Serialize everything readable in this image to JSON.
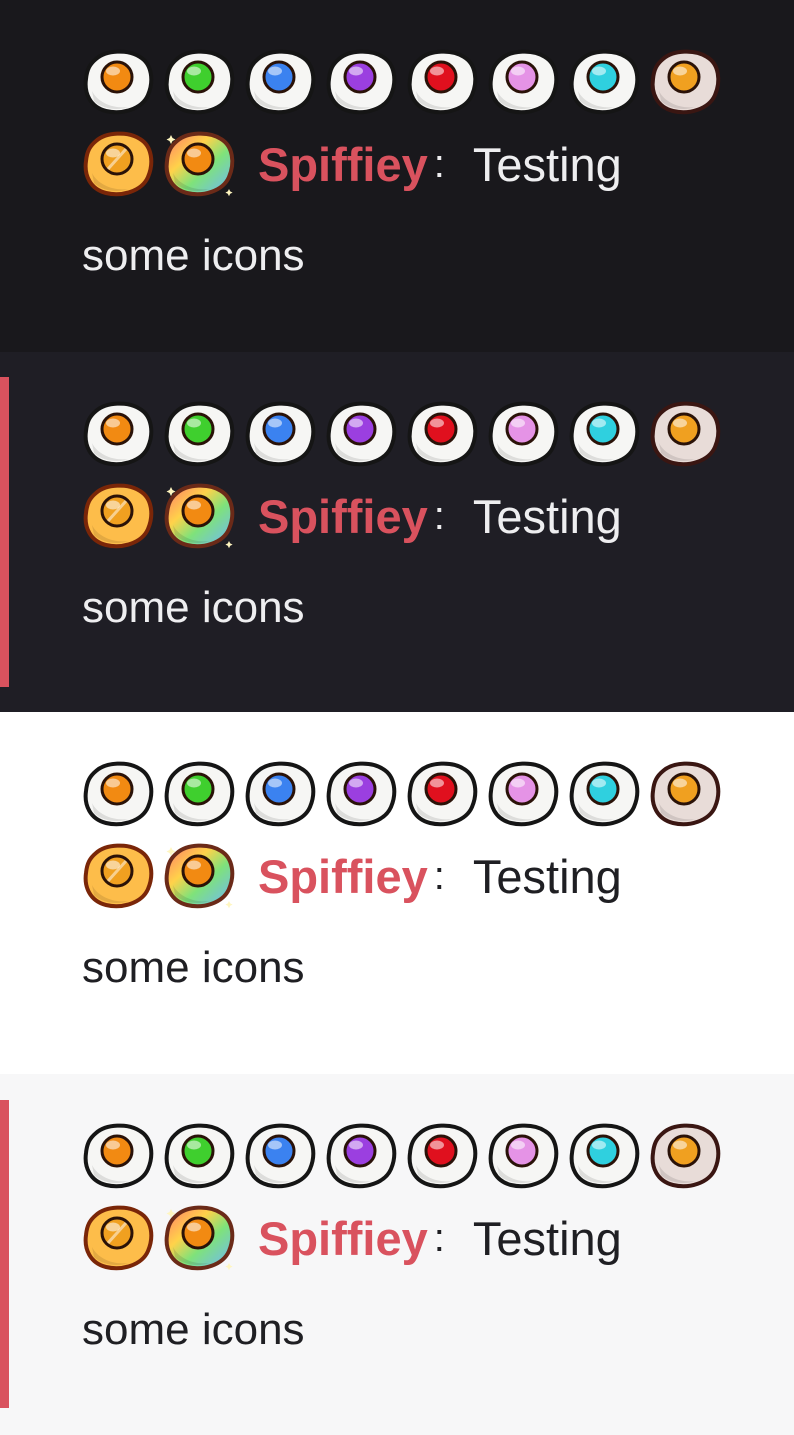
{
  "themes": [
    {
      "id": "dark",
      "bg": "#19181c",
      "text": "#eeeef0",
      "accent": null
    },
    {
      "id": "dark-highlight",
      "bg": "#1f1e25",
      "text": "#eeeef0",
      "accent": "#d9525e"
    },
    {
      "id": "light",
      "bg": "#ffffff",
      "text": "#1f1f23",
      "accent": null
    },
    {
      "id": "light-highlight",
      "bg": "#f7f7f8",
      "text": "#1f1f23",
      "accent": "#d9525e"
    }
  ],
  "message": {
    "username": "Spiffiey",
    "separator": ":",
    "text_line1": "Testing",
    "text_line2": "some icons",
    "username_color": "#d9525e"
  },
  "badges": [
    {
      "name": "orange-egg-icon",
      "yolk": "#f28a12"
    },
    {
      "name": "green-egg-icon",
      "yolk": "#3fcf2e"
    },
    {
      "name": "blue-egg-icon",
      "yolk": "#3b82f0"
    },
    {
      "name": "purple-egg-icon",
      "yolk": "#9b3fe0"
    },
    {
      "name": "red-egg-icon",
      "yolk": "#e0101e"
    },
    {
      "name": "pink-egg-icon",
      "yolk": "#e593e6"
    },
    {
      "name": "cyan-egg-icon",
      "yolk": "#2fd0df"
    },
    {
      "name": "burnt-egg-icon",
      "yolk": "#f0a020"
    },
    {
      "name": "golden-egg-icon",
      "yolk": "#f0a020"
    },
    {
      "name": "rainbow-egg-icon",
      "yolk": "#f28a12"
    }
  ]
}
